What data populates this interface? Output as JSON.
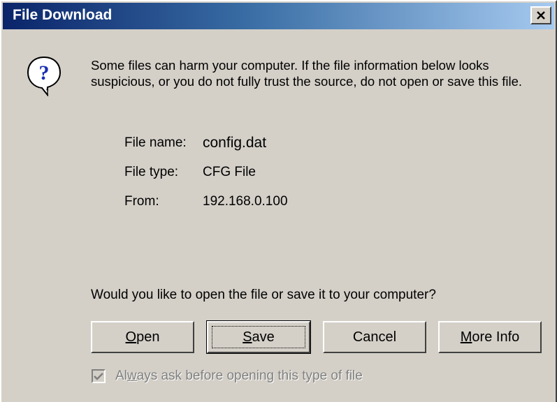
{
  "window": {
    "title": "File Download",
    "close_icon": "close-icon"
  },
  "icon": {
    "name": "question-icon",
    "glyph": "?"
  },
  "message": "Some files can harm your computer. If the file information below looks suspicious, or you do not fully trust the source, do not open or save this file.",
  "file_info": {
    "name_label": "File name:",
    "name_value": "config.dat",
    "type_label": "File type:",
    "type_value": "CFG File",
    "from_label": "From:",
    "from_value": "192.168.0.100"
  },
  "question": "Would you like to open the file or save it to your computer?",
  "buttons": {
    "open": {
      "mnemonic": "O",
      "rest": "pen"
    },
    "save": {
      "mnemonic": "S",
      "rest": "ave"
    },
    "cancel": {
      "label": "Cancel"
    },
    "more_info": {
      "mnemonic": "M",
      "rest": "ore Info"
    }
  },
  "checkbox": {
    "pre": "Al",
    "mnemonic": "w",
    "rest": "ays ask before opening this type of file",
    "checked": true,
    "disabled": true
  },
  "colors": {
    "face": "#d4d0c8",
    "title_start": "#0a246a",
    "title_end": "#a6caf0",
    "disabled_text": "#808080"
  }
}
